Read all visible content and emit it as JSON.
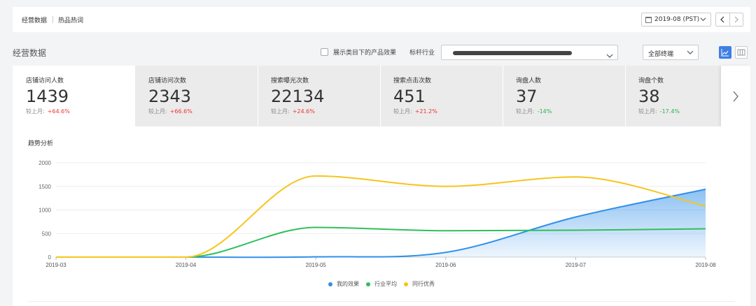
{
  "tabs": [
    {
      "label": "经营数据"
    },
    {
      "label": "热品热词"
    }
  ],
  "date_select": {
    "value": "2019-08 (PST)"
  },
  "section_title": "经营数据",
  "checkbox_label": "展示类目下的产品效果",
  "industry": {
    "label": "标杆行业"
  },
  "terminal_select": {
    "value": "全部终端"
  },
  "colors": {
    "accent": "#3d7fe3",
    "mine": "#2f8fe9",
    "avg": "#2fbf5b",
    "best": "#f6c51a",
    "up": "#ee3333",
    "down": "#2bb34a"
  },
  "metrics": [
    {
      "label": "店铺访问人数",
      "value": "1439",
      "compare_label": "较上月:",
      "change": "+64.6%",
      "direction": "up"
    },
    {
      "label": "店铺访问次数",
      "value": "2343",
      "compare_label": "较上月:",
      "change": "+66.6%",
      "direction": "up"
    },
    {
      "label": "搜索曝光次数",
      "value": "22134",
      "compare_label": "较上月:",
      "change": "+24.6%",
      "direction": "up"
    },
    {
      "label": "搜索点击次数",
      "value": "451",
      "compare_label": "较上月:",
      "change": "+21.2%",
      "direction": "up"
    },
    {
      "label": "询盘人数",
      "value": "37",
      "compare_label": "较上月:",
      "change": "-14%",
      "direction": "down"
    },
    {
      "label": "询盘个数",
      "value": "38",
      "compare_label": "较上月:",
      "change": "-17.4%",
      "direction": "down"
    }
  ],
  "chart_data": {
    "type": "line",
    "title": "趋势分析",
    "categories": [
      "2019-03",
      "2019-04",
      "2019-05",
      "2019-06",
      "2019-07",
      "2019-08"
    ],
    "y_ticks": [
      0,
      500,
      1000,
      1500,
      2000
    ],
    "ylim": [
      0,
      2000
    ],
    "grid": true,
    "legend_position": "bottom",
    "series": [
      {
        "name": "我的效果",
        "color": "#2f8fe9",
        "values": [
          0,
          0,
          5,
          100,
          850,
          1439
        ],
        "area": true
      },
      {
        "name": "行业平均",
        "color": "#2fbf5b",
        "values": [
          0,
          0,
          630,
          560,
          570,
          600
        ]
      },
      {
        "name": "同行优秀",
        "color": "#f6c51a",
        "values": [
          0,
          0,
          1720,
          1500,
          1700,
          1080
        ]
      }
    ]
  }
}
